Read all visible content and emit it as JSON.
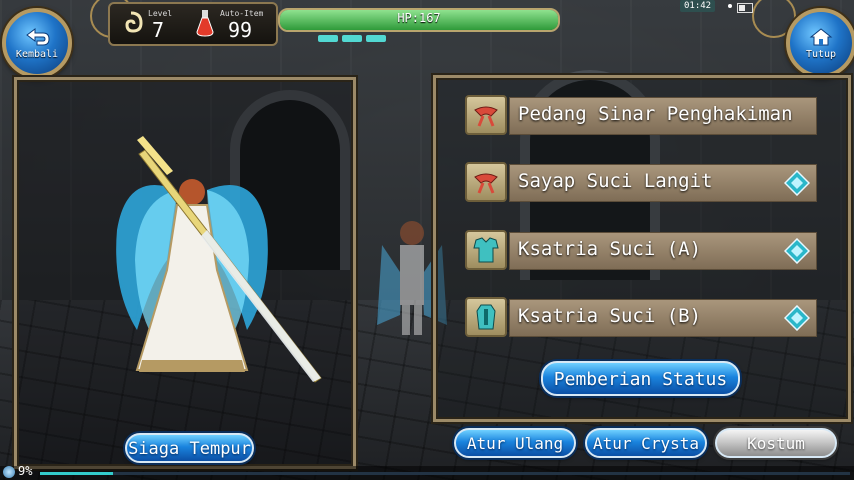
{
  "hud": {
    "back_label": "Kembali",
    "close_label": "Tutup",
    "level_caption": "Level",
    "level_value": "7",
    "auto_item_caption": "Auto-Item",
    "auto_item_value": "99",
    "hp_text": "HP:167",
    "hp_fraction": 1.0,
    "mp_segments": 3,
    "clock": "01:42"
  },
  "equipment": [
    {
      "label": "Pedang Sinar Penghakiman",
      "icon": "bow-icon",
      "has_gem": false
    },
    {
      "label": "Sayap Suci Langit",
      "icon": "bow-icon",
      "has_gem": true
    },
    {
      "label": "Ksatria Suci (A)",
      "icon": "armor-icon",
      "has_gem": true
    },
    {
      "label": "Ksatria Suci (B)",
      "icon": "armor-icon",
      "has_gem": true
    }
  ],
  "buttons": {
    "status": "Pemberian Status",
    "siaga": "Siaga Tempur",
    "reset": "Atur Ulang",
    "crysta": "Atur Crysta",
    "kostum": "Kostum"
  },
  "footer": {
    "exp_percent_text": "9%",
    "exp_fraction": 0.09
  },
  "colors": {
    "accent_blue": "#1a84de",
    "frame_gold": "#9c8a68",
    "hp_green": "#2f9a3a",
    "mp_cyan": "#52d8d2"
  }
}
